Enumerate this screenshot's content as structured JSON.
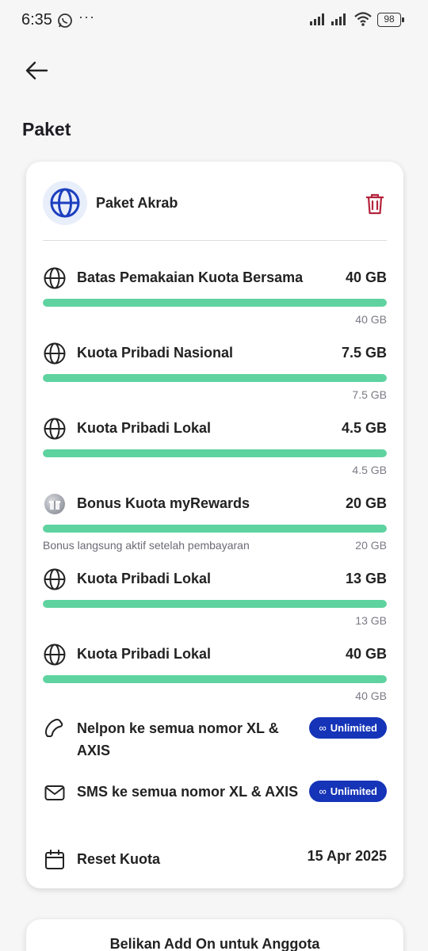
{
  "status_bar": {
    "time": "6:35",
    "dots": "···",
    "battery": "98"
  },
  "page": {
    "title": "Paket"
  },
  "package": {
    "name": "Paket Akrab",
    "items": [
      {
        "label": "Batas Pemakaian Kuota Bersama",
        "value": "40 GB",
        "sub": "40 GB",
        "note": "",
        "progress": 1.0,
        "icon": "globe-icon"
      },
      {
        "label": "Kuota Pribadi Nasional",
        "value": "7.5 GB",
        "sub": "7.5 GB",
        "note": "",
        "progress": 1.0,
        "icon": "globe-icon"
      },
      {
        "label": "Kuota Pribadi Lokal",
        "value": "4.5 GB",
        "sub": "4.5 GB",
        "note": "",
        "progress": 1.0,
        "icon": "globe-icon"
      },
      {
        "label": "Bonus Kuota myRewards",
        "value": "20 GB",
        "sub": "20 GB",
        "note": "Bonus langsung aktif setelah pembayaran",
        "progress": 1.0,
        "icon": "gift-icon"
      },
      {
        "label": "Kuota Pribadi Lokal",
        "value": "13 GB",
        "sub": "13 GB",
        "note": "",
        "progress": 1.0,
        "icon": "globe-icon"
      },
      {
        "label": "Kuota Pribadi Lokal",
        "value": "40 GB",
        "sub": "40 GB",
        "note": "",
        "progress": 1.0,
        "icon": "globe-icon"
      }
    ],
    "unlimited": [
      {
        "label": "Nelpon ke semua nomor XL & AXIS",
        "badge": "Unlimited",
        "icon": "phone-icon"
      },
      {
        "label": "SMS ke semua nomor XL & AXIS",
        "badge": "Unlimited",
        "icon": "envelope-icon"
      }
    ],
    "reset": {
      "label": "Reset Kuota",
      "value": "15 Apr 2025"
    }
  },
  "addon": {
    "title": "Belikan Add On untuk Anggota"
  },
  "colors": {
    "progress": "#5ed3a0",
    "badge": "#1534b8",
    "trash": "#b4233c",
    "globe_main": "#1c3fbf"
  }
}
